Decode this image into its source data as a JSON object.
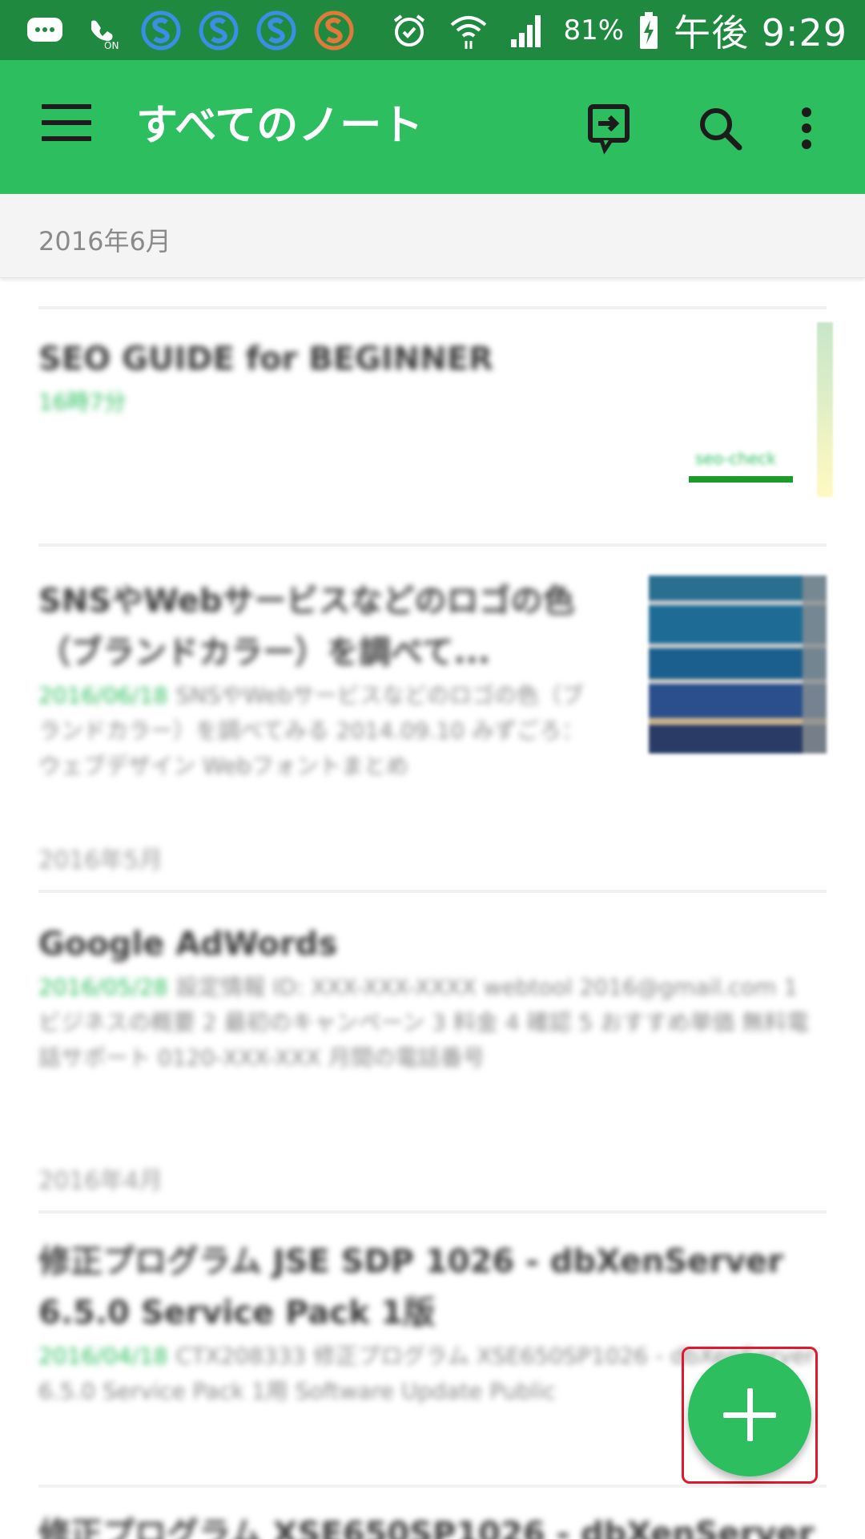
{
  "status_bar": {
    "icons": [
      "message-icon",
      "volte-icon",
      "skype-icon",
      "skype-icon",
      "skype-icon",
      "skype-orange-icon",
      "alarm-icon",
      "wifi-icon",
      "signal-icon"
    ],
    "battery": "81%",
    "time": "午後 9:29"
  },
  "toolbar": {
    "title": "すべてのノート",
    "menu_icon": "hamburger-menu-icon",
    "sync_icon": "sync-icon",
    "search_icon": "search-icon",
    "more_icon": "more-vert-icon"
  },
  "list": {
    "month_header": "2016年6月",
    "notes": [
      {
        "title": "SEO GUIDE for BEGINNER",
        "date": "16時7分",
        "tag": "seo-check"
      },
      {
        "title": "SNSやWebサービスなどのロゴの色（ブランドカラー）を調べて...",
        "date": "2016/06/18",
        "snippet": "SNSやWebサービスなどのロゴの色（ブランドカラー）を調べてみる 2014.09.10 みずごろ：ウェブデザイン Webフォントまとめ"
      },
      {
        "title": "Google AdWords",
        "date": "2016/05/28",
        "snippet": "設定情報 ID: XXX-XXX-XXXX webtool 2016@gmail.com 1 ビジネスの概要 2 最初のキャンペーン 3 料金 4 確認 5 おすすめ単価 無料電話サポート 0120-XXX-XXX 月間の電話番号"
      },
      {
        "title": "修正プログラム JSE SDP 1026 - dbXenServer 6.5.0 Service Pack 1版",
        "date": "2016/04/18",
        "snippet": "CTX208333 修正プログラム XSE650SP1026 - dbXenServer 6.5.0 Service Pack 1用 Software Update Public"
      }
    ],
    "section_dates": [
      "2016年5月",
      "2016年4月"
    ],
    "partial_last_title": "修正プログラム XSE650SP1026 - dbXenServer"
  },
  "fab": {
    "icon": "plus-icon"
  }
}
